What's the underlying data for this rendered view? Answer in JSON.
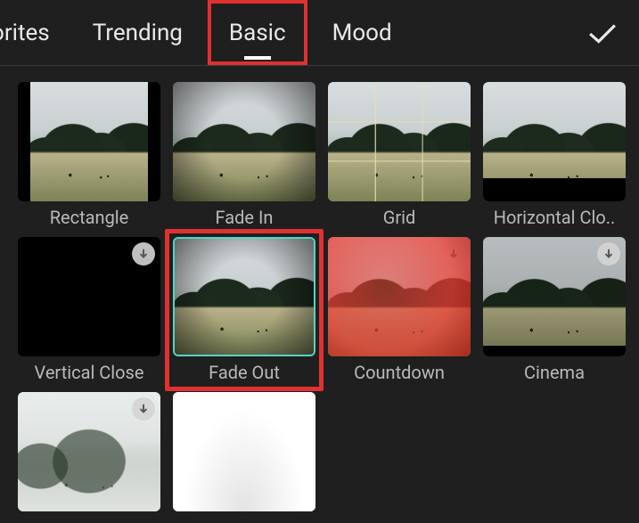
{
  "tabs": {
    "favorites": "orites",
    "trending": "Trending",
    "basic": "Basic",
    "mood": "Mood",
    "active": "basic",
    "highlighted": "basic"
  },
  "effects": {
    "rectangle": {
      "label": "Rectangle",
      "download": false
    },
    "fade_in": {
      "label": "Fade In",
      "download": false
    },
    "grid": {
      "label": "Grid",
      "download": false
    },
    "horizontal_close": {
      "label": "Horizontal Clo..",
      "download": false
    },
    "vertical_close": {
      "label": "Vertical Close",
      "download": true
    },
    "fade_out": {
      "label": "Fade Out",
      "download": false,
      "selected": true
    },
    "countdown": {
      "label": "Countdown",
      "download": true
    },
    "cinema": {
      "label": "Cinema",
      "download": true
    },
    "row3_a": {
      "label": "",
      "download": true
    },
    "row3_b": {
      "label": "",
      "download": true
    }
  },
  "colors": {
    "highlight_red": "#e03131",
    "select_teal": "#4fd6c8",
    "bg": "#1f1f1f"
  }
}
